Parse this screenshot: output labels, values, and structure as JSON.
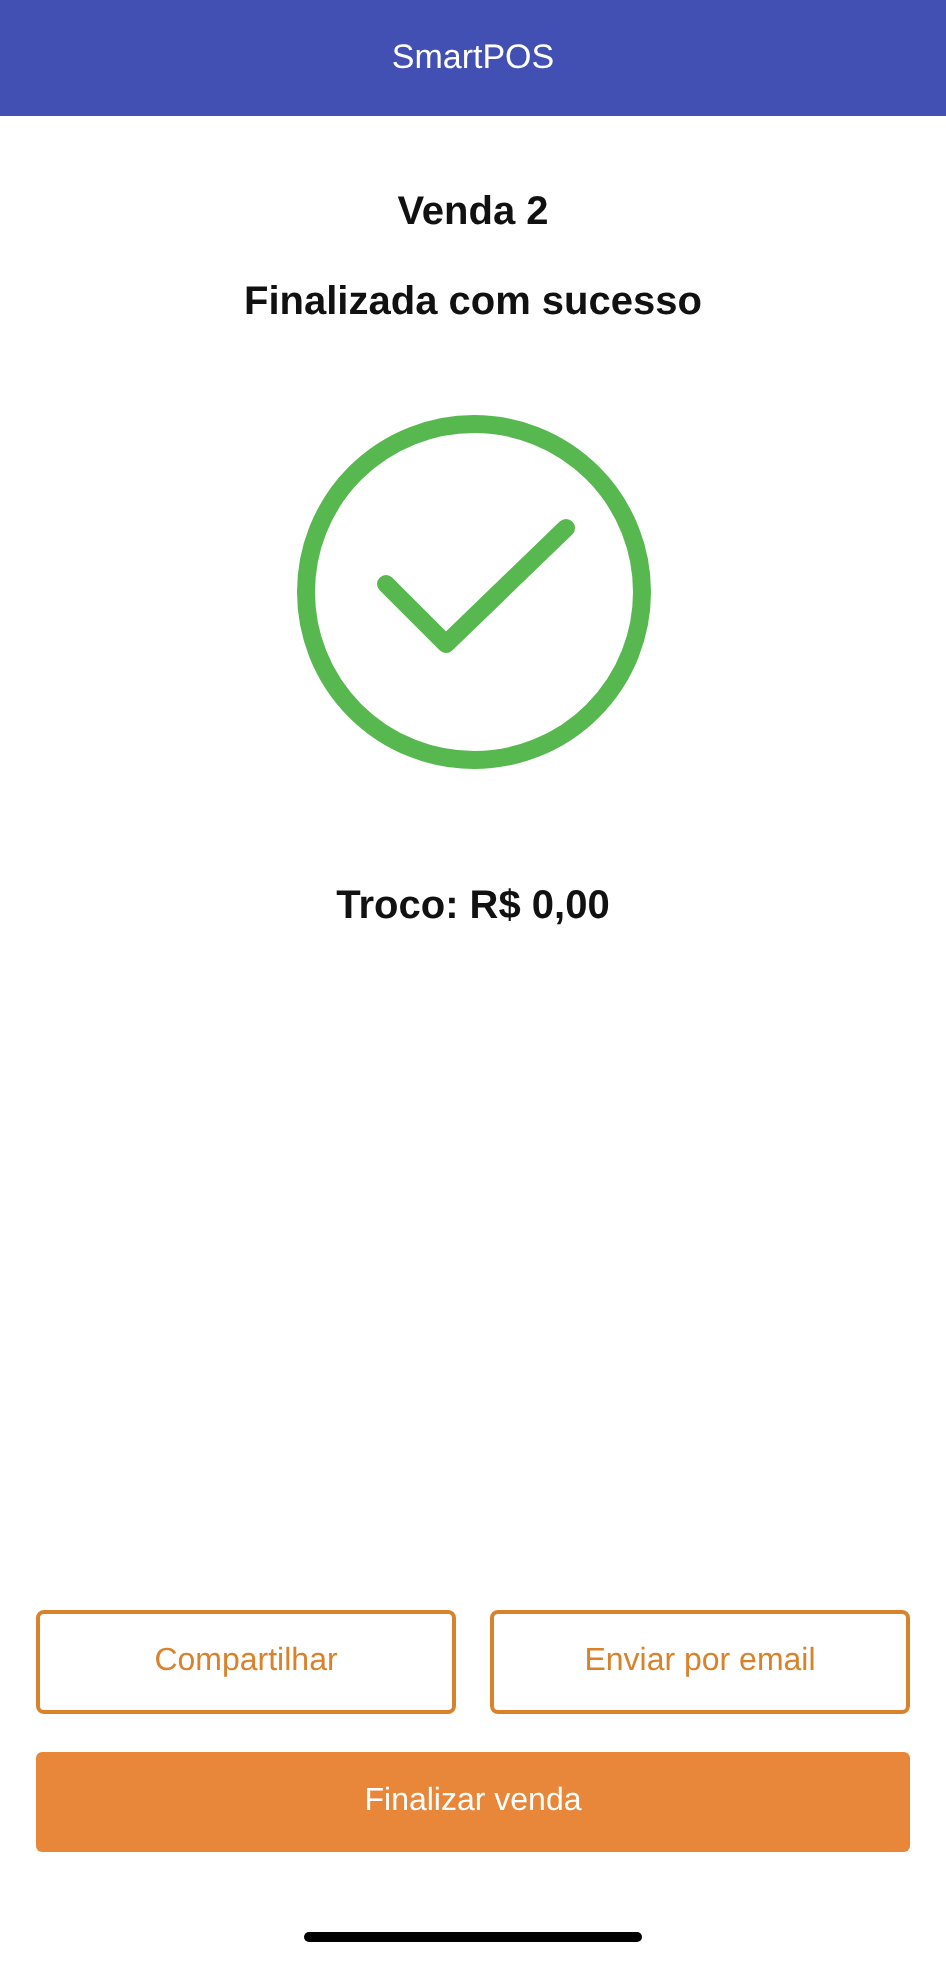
{
  "header": {
    "title": "SmartPOS"
  },
  "sale": {
    "title": "Venda 2",
    "status": "Finalizada com sucesso",
    "change": "Troco: R$ 0,00"
  },
  "secondary_buttons": [
    {
      "label": "Compartilhar"
    },
    {
      "label": "Enviar por email"
    }
  ],
  "primary_button": {
    "label": "Finalizar venda"
  }
}
